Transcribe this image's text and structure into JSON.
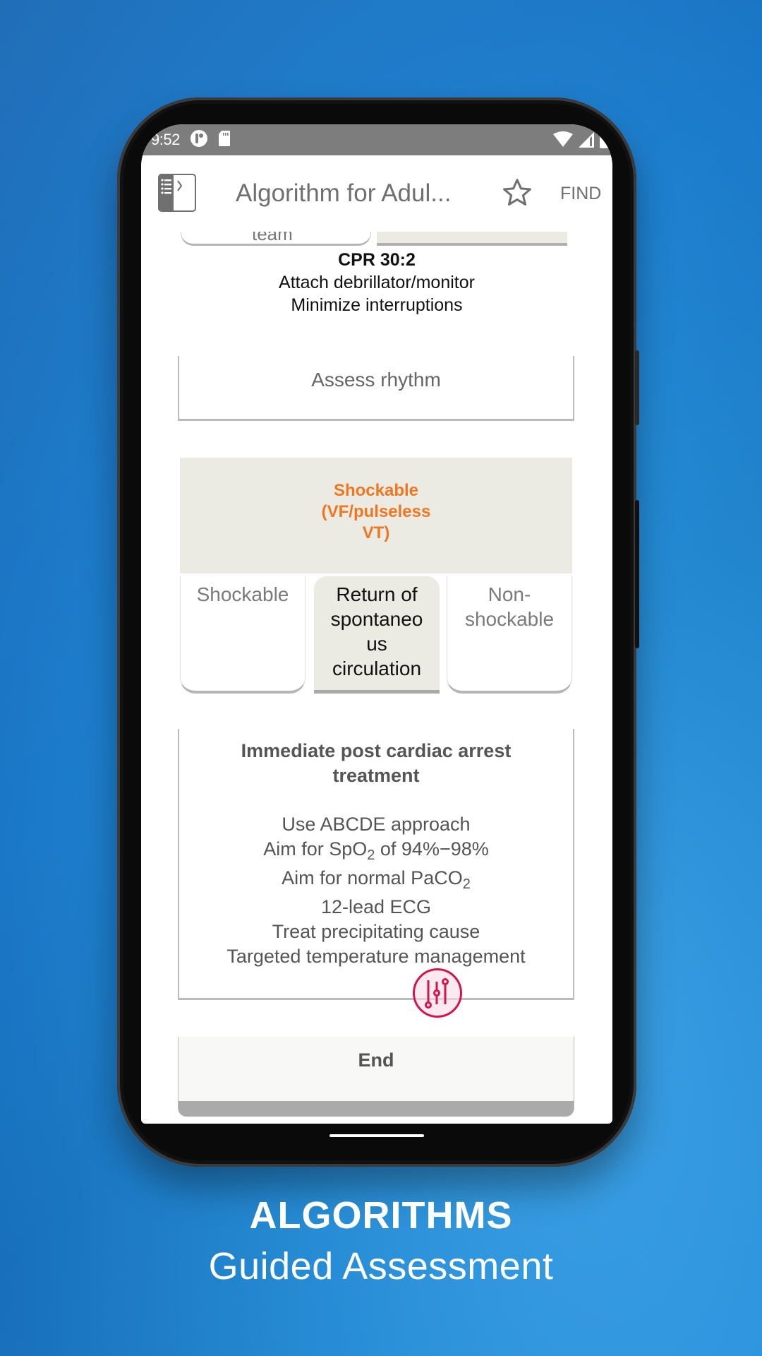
{
  "status_bar": {
    "time": "9:52",
    "left_icons": [
      "app-notification-icon",
      "sd-card-icon"
    ],
    "right_icons": [
      "wifi-icon",
      "cell-signal-icon",
      "battery-icon"
    ]
  },
  "app_bar": {
    "menu_icon": "sidebar-toggle-icon",
    "title": "Algorithm for Adul...",
    "favorite_icon": "star-outline-icon",
    "find_label": "FIND"
  },
  "algorithm": {
    "previous_option_partial": "team",
    "cpr_block": {
      "heading": "CPR 30:2",
      "lines": [
        "Attach debrillator/monitor",
        "Minimize interruptions"
      ]
    },
    "assess_box": {
      "label": "Assess rhythm"
    },
    "selected_branch_header": {
      "lines": [
        "Shockable",
        "(VF/pulseless",
        "VT)"
      ],
      "color": "#f07722"
    },
    "options": [
      {
        "label": "Shockable",
        "selected": false
      },
      {
        "label": "Return of spontaneo us circulation",
        "selected": true
      },
      {
        "label": "Non- shockable",
        "selected": false
      }
    ],
    "treatment_box": {
      "heading": "Immediate post cardiac arrest treatment",
      "lines": [
        {
          "text": "Use ABCDE approach"
        },
        {
          "pre": "Aim for SpO",
          "sub": "2",
          "post": " of 94%−98%"
        },
        {
          "pre": "Aim for normal PaCO",
          "sub": "2",
          "post": ""
        },
        {
          "text": "12-lead ECG"
        },
        {
          "text": "Treat precipitating cause"
        },
        {
          "text": "Targeted temperature management"
        }
      ]
    },
    "end_box": {
      "label": "End"
    }
  },
  "fab": {
    "icon": "sliders-icon",
    "color": "#d4144a"
  },
  "caption": {
    "title": "ALGORITHMS",
    "subtitle": "Guided Assessment"
  }
}
